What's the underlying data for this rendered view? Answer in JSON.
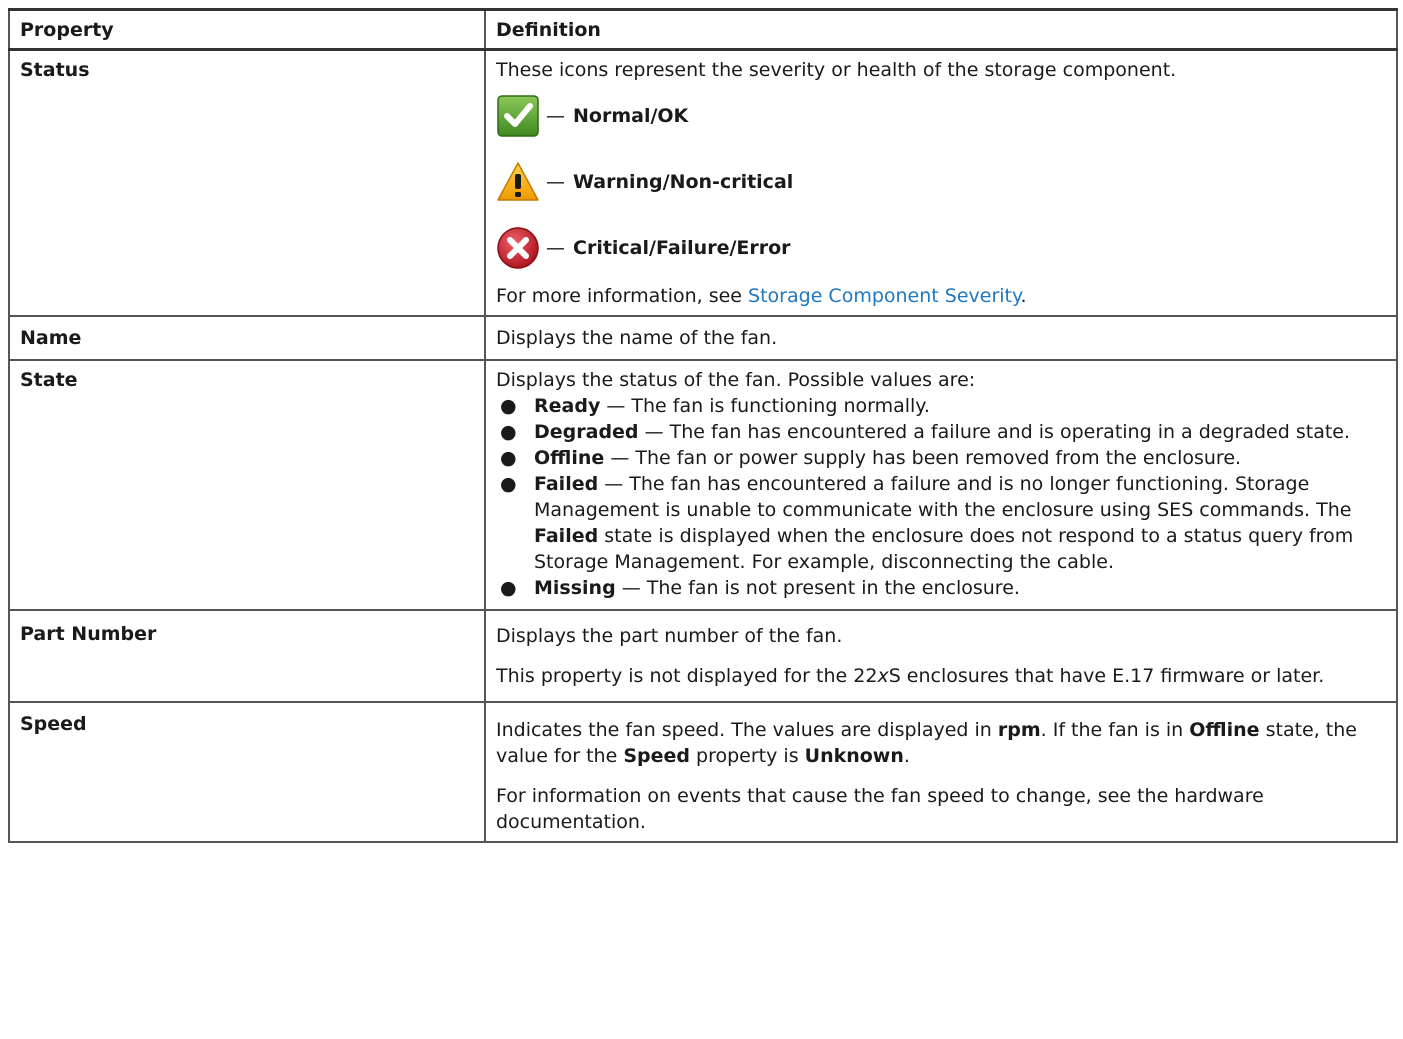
{
  "table": {
    "headers": {
      "property": "Property",
      "definition": "Definition"
    },
    "status": {
      "label": "Status",
      "intro": "These icons represent the severity or health of the storage component.",
      "dash": "—",
      "items": [
        {
          "icon": "check-icon",
          "color": "#4e9a28",
          "label": "Normal/OK"
        },
        {
          "icon": "warning-icon",
          "color": "#f5a300",
          "label": "Warning/Non-critical"
        },
        {
          "icon": "error-icon",
          "color": "#c8202a",
          "label": "Critical/Failure/Error"
        }
      ],
      "more_prefix": "For more information, see ",
      "more_link": "Storage Component Severity",
      "more_suffix": "."
    },
    "name": {
      "label": "Name",
      "definition": "Displays the name of the fan."
    },
    "state": {
      "label": "State",
      "intro": "Displays the status of the fan. Possible values are:",
      "bullet": "●",
      "items": [
        {
          "term": "Ready",
          "text": " — The fan is functioning normally."
        },
        {
          "term": "Degraded",
          "text": " — The fan has encountered a failure and is operating in a degraded state."
        },
        {
          "term": "Offline",
          "text": " — The fan or power supply has been removed from the enclosure."
        },
        {
          "term": "Failed",
          "text": " — The fan has encountered a failure and is no longer functioning. Storage Management is unable to communicate with the enclosure using SES commands. The ",
          "term2": "Failed",
          "text2": " state is displayed when the enclosure does not respond to a status query from Storage Management. For example, disconnecting the cable."
        },
        {
          "term": "Missing",
          "text": " — The fan is not present in the enclosure."
        }
      ]
    },
    "part_number": {
      "label": "Part Number",
      "para1": "Displays the part number of the fan.",
      "para2_a": "This property is not displayed for the 22",
      "para2_italic": "x",
      "para2_b": "S enclosures that have E.17 firmware or later."
    },
    "speed": {
      "label": "Speed",
      "p1_a": "Indicates the fan speed. The values are displayed in ",
      "p1_rpm": "rpm",
      "p1_b": ". If the fan is in ",
      "p1_offline": "Offline",
      "p1_c": " state, the value for the ",
      "p1_speed": "Speed",
      "p1_d": " property is ",
      "p1_unknown": "Unknown",
      "p1_e": ".",
      "para2": "For information on events that cause the fan speed to change, see the hardware documentation."
    }
  }
}
